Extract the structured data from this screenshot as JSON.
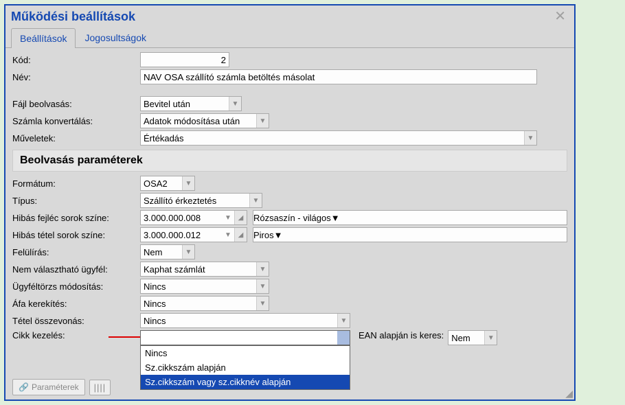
{
  "window_title": "Működési beállítások",
  "tabs": {
    "settings": "Beállítások",
    "perms": "Jogosultságok"
  },
  "labels": {
    "kod": "Kód:",
    "nev": "Név:",
    "fajl": "Fájl beolvasás:",
    "szamla": "Számla konvertálás:",
    "muv": "Műveletek:",
    "section": "Beolvasás paraméterek",
    "formatum": "Formátum:",
    "tipus": "Típus:",
    "hibas_fejlec": "Hibás fejléc sorok színe:",
    "hibas_tetel": "Hibás tétel sorok színe:",
    "felul": "Felülírás:",
    "nemval": "Nem választható ügyfél:",
    "ugyfel": "Ügyféltörzs módosítás:",
    "afa": "Áfa kerekítés:",
    "tetel": "Tétel összevonás:",
    "cikk": "Cikk kezelés:",
    "ean": "EAN alapján is keres:"
  },
  "values": {
    "kod": "2",
    "nev": "NAV OSA szállító számla betöltés másolat",
    "fajl": "Bevitel után",
    "szamla": "Adatok módosítása után",
    "muv": "Értékadás",
    "formatum": "OSA2",
    "tipus": "Szállító érkeztetés",
    "hibas_fejlec_code": "3.000.000.008",
    "hibas_fejlec_color": "Rózsaszín - világos",
    "hibas_tetel_code": "3.000.000.012",
    "hibas_tetel_color": "Piros",
    "felul": "Nem",
    "nemval": "Kaphat számlát",
    "ugyfel": "Nincs",
    "afa": "Nincs",
    "tetel": "Nincs",
    "ean": "Nem"
  },
  "dropdown": {
    "opt1": "Nincs",
    "opt2": "Sz.cikkszám alapján",
    "opt3": "Sz.cikkszám vagy sz.cikknév alapján"
  },
  "footer": {
    "params": "Paraméterek",
    "barcode_hint": "|||"
  }
}
